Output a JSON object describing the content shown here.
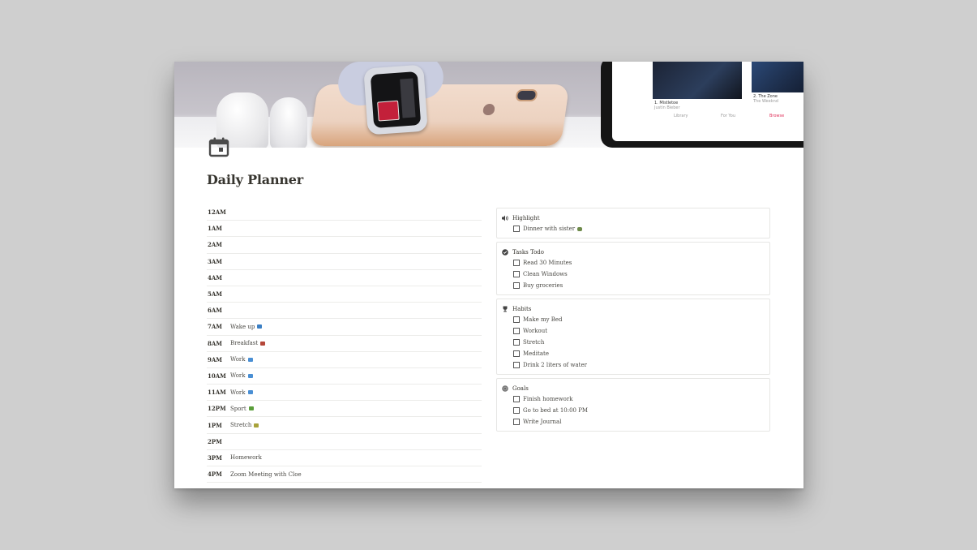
{
  "page": {
    "title": "Daily Planner",
    "icon": "calendar-icon",
    "cover": {
      "description": "Apple devices on a desk: AirPods, Apple Watch, iPhone, iPad showing Apple Music",
      "tablet_captions": {
        "album1_title": "1. Mistletoe",
        "album1_artist": "Justin Bieber",
        "album2_title": "2. The Zone",
        "album2_artist": "The Weeknd",
        "tabs": [
          "Library",
          "For You",
          "Browse"
        ]
      }
    }
  },
  "schedule": [
    {
      "time": "12AM",
      "task": ""
    },
    {
      "time": "1AM",
      "task": ""
    },
    {
      "time": "2AM",
      "task": ""
    },
    {
      "time": "3AM",
      "task": ""
    },
    {
      "time": "4AM",
      "task": ""
    },
    {
      "time": "5AM",
      "task": ""
    },
    {
      "time": "6AM",
      "task": ""
    },
    {
      "time": "7AM",
      "task": "Wake up",
      "emoji": "bed-icon",
      "emoji_color": "#3b7fc4"
    },
    {
      "time": "8AM",
      "task": "Breakfast",
      "emoji": "coffee-icon",
      "emoji_color": "#b5473a"
    },
    {
      "time": "9AM",
      "task": "Work",
      "emoji": "laptop-icon",
      "emoji_color": "#4a8fd4"
    },
    {
      "time": "10AM",
      "task": "Work",
      "emoji": "laptop-icon",
      "emoji_color": "#4a8fd4"
    },
    {
      "time": "11AM",
      "task": "Work",
      "emoji": "laptop-icon",
      "emoji_color": "#4a8fd4"
    },
    {
      "time": "12PM",
      "task": "Sport",
      "emoji": "runner-icon",
      "emoji_color": "#5a9e3a"
    },
    {
      "time": "1PM",
      "task": "Stretch",
      "emoji": "person-stretching-icon",
      "emoji_color": "#a8a23a"
    },
    {
      "time": "2PM",
      "task": ""
    },
    {
      "time": "3PM",
      "task": "Homework"
    },
    {
      "time": "4PM",
      "task": "Zoom Meeting with Cloe"
    }
  ],
  "cards": [
    {
      "title": "Highlight",
      "icon": "speaker-icon",
      "items": [
        {
          "label": "Dinner with sister",
          "checked": false,
          "emoji": "plate-icon",
          "emoji_color": "#6e8a4a"
        }
      ]
    },
    {
      "title": "Tasks Todo",
      "icon": "check-circle-icon",
      "items": [
        {
          "label": "Read 30 Minutes",
          "checked": false
        },
        {
          "label": "Clean Windows",
          "checked": false
        },
        {
          "label": "Buy groceries",
          "checked": false
        }
      ]
    },
    {
      "title": "Habits",
      "icon": "trophy-icon",
      "items": [
        {
          "label": "Make my Bed",
          "checked": false
        },
        {
          "label": "Workout",
          "checked": false
        },
        {
          "label": "Stretch",
          "checked": false
        },
        {
          "label": "Meditate",
          "checked": false
        },
        {
          "label": "Drink 2 liters of water",
          "checked": false
        }
      ]
    },
    {
      "title": "Goals",
      "icon": "target-icon",
      "items": [
        {
          "label": "Finish homework",
          "checked": false
        },
        {
          "label": "Go to bed at 10:00 PM",
          "checked": false
        },
        {
          "label": "Write Journal",
          "checked": false
        }
      ]
    }
  ]
}
